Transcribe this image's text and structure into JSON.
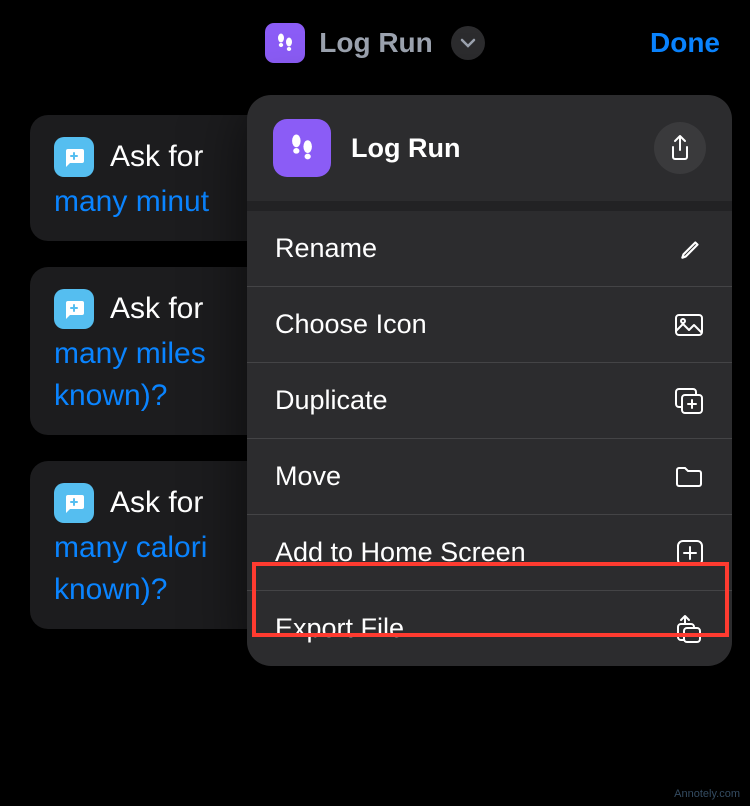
{
  "header": {
    "title": "Log Run",
    "done": "Done"
  },
  "actions": {
    "card1": {
      "label": "Ask for",
      "subtext": "many minut"
    },
    "card2": {
      "label": "Ask for",
      "subtext1": "many miles",
      "subtext2": "known)?"
    },
    "card3": {
      "label": "Ask for",
      "subtext1": "many calori",
      "subtext2": "known)?"
    }
  },
  "sheet": {
    "title": "Log Run",
    "items": {
      "rename": "Rename",
      "choose_icon": "Choose Icon",
      "duplicate": "Duplicate",
      "move": "Move",
      "add_home": "Add to Home Screen",
      "export": "Export File"
    }
  },
  "watermark": "Annotely.com"
}
